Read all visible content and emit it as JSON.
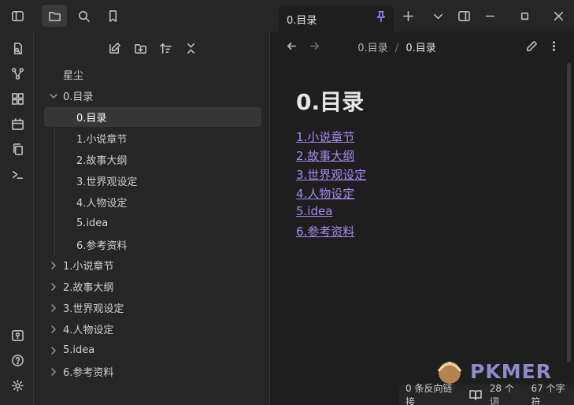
{
  "sidebar": {
    "vault_name": "星尘",
    "tree": [
      {
        "label": "0.目录",
        "expanded": true,
        "children": [
          "0.目录",
          "1.小说章节",
          "2.故事大纲",
          "3.世界观设定",
          "4.人物设定",
          "5.idea",
          "6.参考资料"
        ]
      },
      {
        "label": "1.小说章节",
        "expanded": false
      },
      {
        "label": "2.故事大纲",
        "expanded": false
      },
      {
        "label": "3.世界观设定",
        "expanded": false
      },
      {
        "label": "4.人物设定",
        "expanded": false
      },
      {
        "label": "5.idea",
        "expanded": false
      },
      {
        "label": "6.参考资料",
        "expanded": false
      }
    ]
  },
  "tab": {
    "title": "0.目录",
    "pinned": true
  },
  "breadcrumb": {
    "folder": "0.目录",
    "separator": "/",
    "file": "0.目录"
  },
  "document": {
    "title": "0.目录",
    "links": [
      "1.小说章节",
      "2.故事大纲",
      "3.世界观设定",
      "4.人物设定",
      "5.idea",
      "6.参考资料"
    ]
  },
  "status": {
    "backlinks": "0 条反向链接",
    "words": "28 个词",
    "chars": "67 个字符"
  },
  "watermark": {
    "text": "PKMER"
  },
  "colors": {
    "accent": "#a882ff",
    "link": "#a48af0",
    "bg": "#1e1e1e",
    "sidebar_bg": "#262626"
  }
}
